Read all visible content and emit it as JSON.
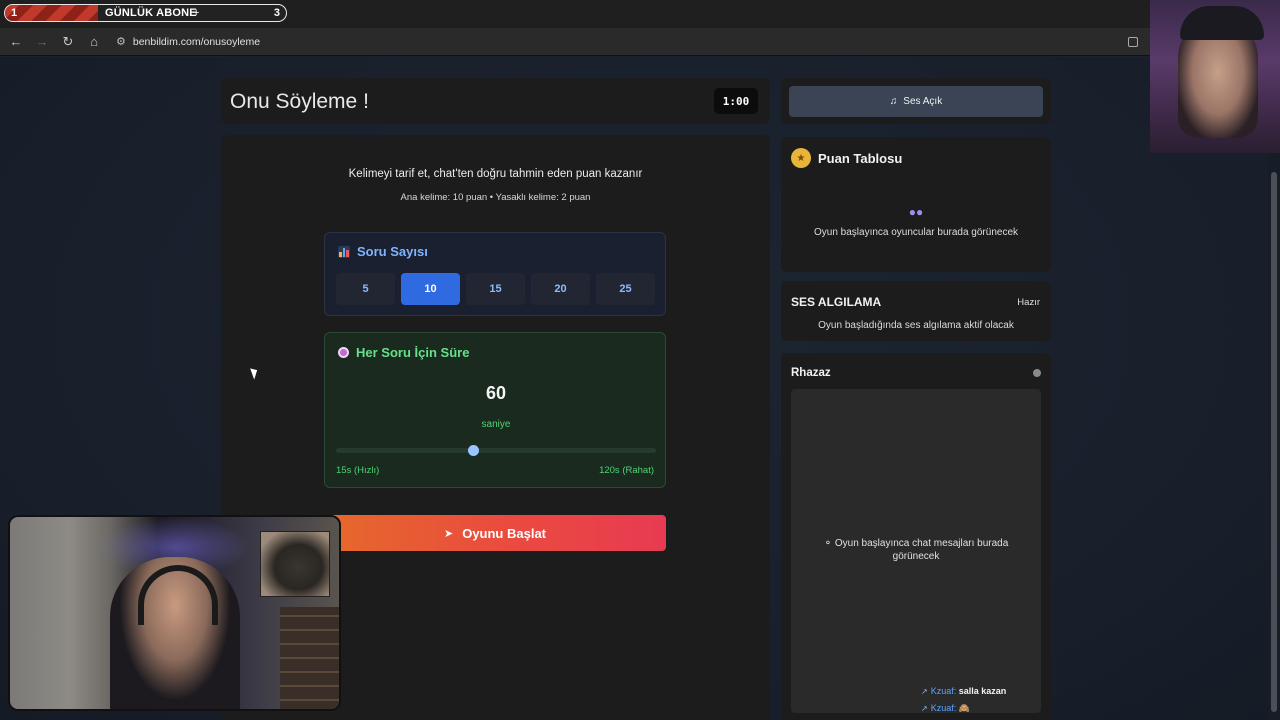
{
  "overlay": {
    "left_number": "1",
    "title": "GÜNLÜK ABONE",
    "plus": "+",
    "right_number": "3",
    "progress_fraction": 0.33
  },
  "browser": {
    "url": "benbildim.com/onusoyleme",
    "icons": [
      "back-icon",
      "forward-icon",
      "reload-icon",
      "home-icon",
      "site-info-icon"
    ]
  },
  "header": {
    "title": "Onu Söyleme !",
    "timer": "1:00"
  },
  "main": {
    "instruction": "Kelimeyi tarif et, chat'ten doğru tahmin eden puan kazanır",
    "scoring": "Ana kelime: 10 puan • Yasaklı kelime: 2 puan",
    "question_count": {
      "label": "Soru Sayısı",
      "options": [
        "5",
        "10",
        "15",
        "20",
        "25"
      ],
      "selected": "10"
    },
    "time_per_question": {
      "label": "Her Soru İçin Süre",
      "value": "60",
      "unit": "saniye",
      "min_label": "15s (Hızlı)",
      "max_label": "120s (Rahat)",
      "min": 15,
      "max": 120,
      "current": 60
    },
    "start_button": "Oyunu Başlat"
  },
  "sidebar": {
    "sound_button": "Ses Açık",
    "scoreboard": {
      "title": "Puan Tablosu",
      "empty_text": "Oyun başlayınca oyuncular burada görünecek"
    },
    "voice_detection": {
      "title": "SES ALGILAMA",
      "status": "Hazır",
      "message": "Oyun başladığında ses algılama aktif olacak"
    },
    "chat": {
      "channel": "Rhazaz",
      "empty_text": "Oyun başlayınca chat mesajları burada görünecek",
      "messages": [
        {
          "user": "Kzuaf:",
          "text": "salla kazan"
        },
        {
          "user": "Kzuaf:",
          "text": "🙈"
        }
      ]
    }
  },
  "colors": {
    "accent_blue": "#2f6ae0",
    "green_text": "#4fd374",
    "start_gradient_from": "#e56a2b",
    "start_gradient_to": "#e83a52"
  }
}
